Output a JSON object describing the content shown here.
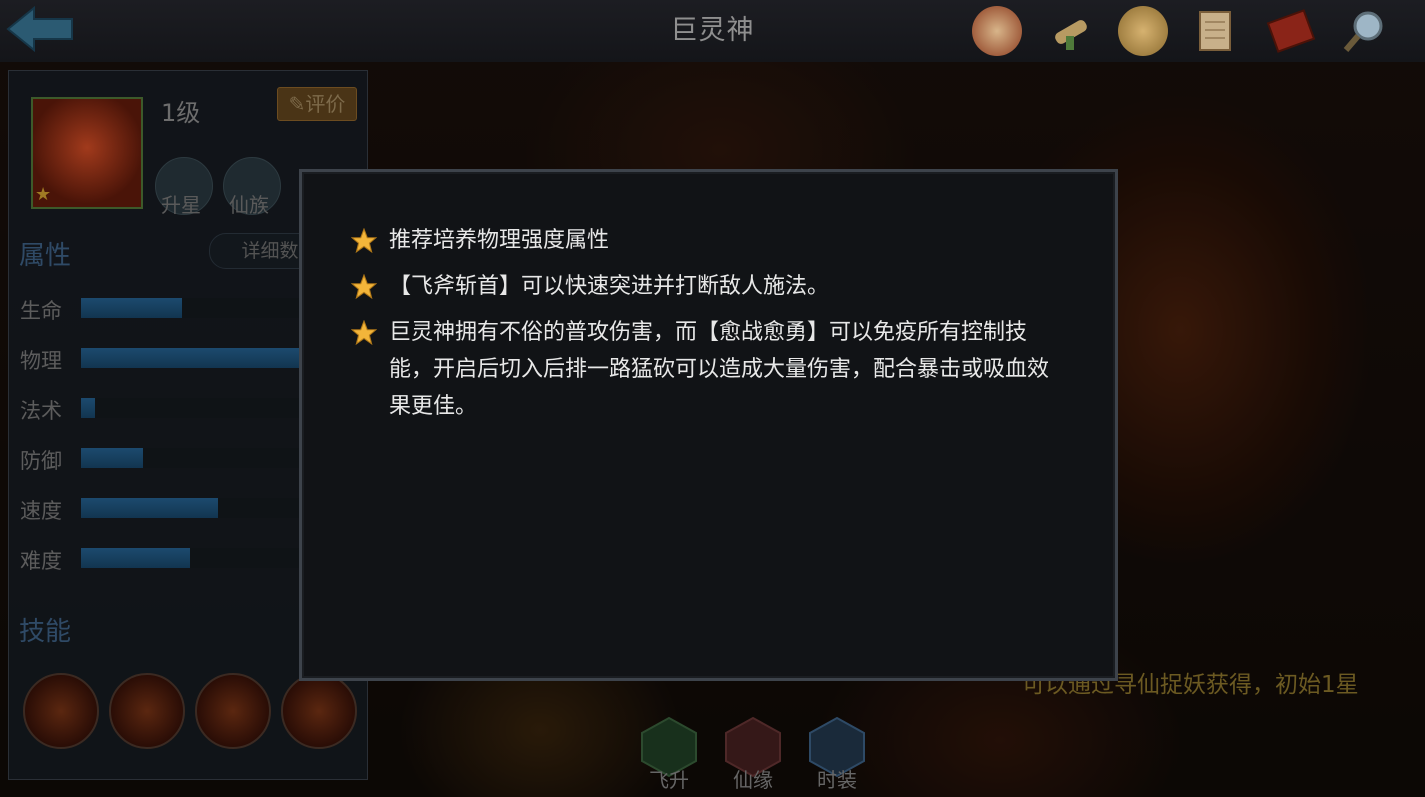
{
  "header": {
    "title": "巨灵神",
    "icons": [
      "battle-seal-icon",
      "scroll-icon",
      "coin-icon",
      "document-icon",
      "book-icon",
      "magnifier-icon"
    ]
  },
  "hero": {
    "level": "1级",
    "rate_label": "评价",
    "stars": "★",
    "buttons": [
      "升星",
      "仙族"
    ]
  },
  "attributes": {
    "title": "属性",
    "detail_label": "详细数",
    "stats": [
      {
        "label": "生命",
        "value": 0.36
      },
      {
        "label": "物理",
        "value": 1.0
      },
      {
        "label": "法术",
        "value": 0.05
      },
      {
        "label": "防御",
        "value": 0.22
      },
      {
        "label": "速度",
        "value": 0.49
      },
      {
        "label": "难度",
        "value": 0.39
      }
    ]
  },
  "skills": {
    "title": "技能"
  },
  "bottom_tabs": [
    "飞升",
    "仙缘",
    "时装"
  ],
  "acquire_text": "可以通过寻仙捉妖获得，初始1星",
  "modal": {
    "tips": [
      "推荐培养物理强度属性",
      "【飞斧斩首】可以快速突进并打断敌人施法。",
      "巨灵神拥有不俗的普攻伤害，而【愈战愈勇】可以免疫所有控制技能，开启后切入后排一路猛砍可以造成大量伤害，配合暴击或吸血效果更佳。"
    ]
  },
  "colors": {
    "accent_blue": "#1c4a6e",
    "star_gold": "#f3b53a",
    "modal_bg": "#111316"
  }
}
